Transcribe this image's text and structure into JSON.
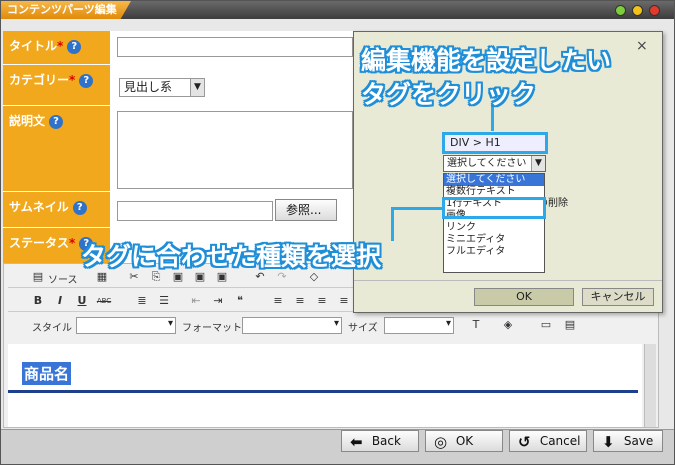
{
  "window": {
    "title": "コンテンツパーツ編集"
  },
  "colors": {
    "label_bg": "#f2a81c",
    "accent_blue": "#2da8e8",
    "selection": "#3875d7"
  },
  "form": {
    "title_label": "タイトル",
    "category_label": "カテゴリー",
    "category_value": "見出し系",
    "description_label": "説明文",
    "thumbnail_label": "サムネイル",
    "browse_button": "参照...",
    "status_label": "ステータス",
    "required_mark": "*",
    "help_icon": "?"
  },
  "toolbar": {
    "source": "ソース",
    "style_label": "スタイル",
    "format_label": "フォーマット",
    "size_label": "サイズ",
    "bold": "B",
    "italic": "I",
    "underline": "U",
    "strike": "ABC"
  },
  "editor_content": {
    "heading_text": "商品名"
  },
  "popup": {
    "path_text": "DIV  >  H1",
    "select_value": "選択してください",
    "options": [
      "選択してください",
      "複数行テキスト",
      "1行テキスト",
      "画像",
      "リンク",
      "ミニエディタ",
      "フルエディタ"
    ],
    "delete_text": "の削除",
    "ok_button": "OK",
    "cancel_button": "キャンセル",
    "close_icon": "×"
  },
  "annotations": {
    "top_line1": "編集機能を設定したい",
    "top_line2": "タグをクリック",
    "middle": "タグに合わせた種類を選択"
  },
  "bottom": {
    "back": "Back",
    "ok": "OK",
    "cancel": "Cancel",
    "save": "Save"
  }
}
